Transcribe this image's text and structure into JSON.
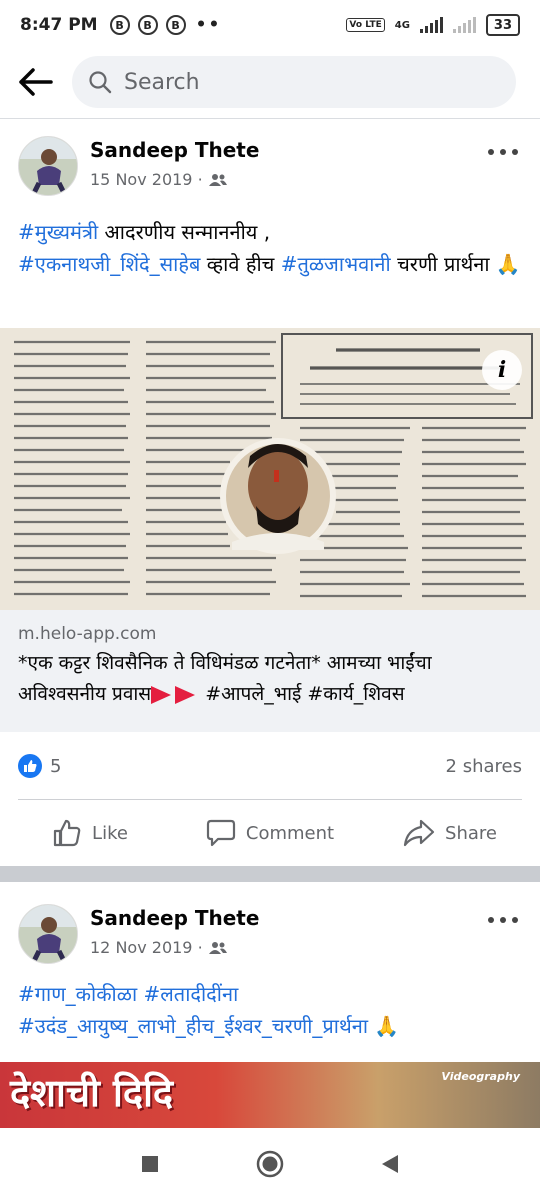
{
  "status_bar": {
    "time": "8:47 PM",
    "badges": [
      "B",
      "B",
      "B"
    ],
    "dots": "••",
    "volte": "Vo LTE",
    "network": "4G",
    "battery": "33"
  },
  "header": {
    "search_placeholder": "Search"
  },
  "posts": [
    {
      "author": "Sandeep Thete",
      "date": "15 Nov 2019 ·",
      "text_parts": [
        {
          "text": "#मुख्यमंत्री",
          "hashtag": true
        },
        {
          "text": " आदरणीय सन्माननीय ,",
          "hashtag": false
        },
        {
          "text": "#एकनाथजी_शिंदे_साहेब",
          "hashtag": true
        },
        {
          "text": " व्हावे हीच ",
          "hashtag": false
        },
        {
          "text": "#तुळजाभवानी",
          "hashtag": true
        },
        {
          "text": " चरणी प्रार्थना 🙏",
          "hashtag": false
        }
      ],
      "link": {
        "domain": "m.helo-app.com",
        "title_part1": "*एक कट्टर शिवसैनिक ते विधिमंडळ गटनेता* आमच्या भाईंचा अविश्वसनीय प्रवास",
        "title_part2": " #आपले_भाई #कार्य_शिवस"
      },
      "info_label": "i",
      "reactions_count": "5",
      "shares": "2 shares"
    },
    {
      "author": "Sandeep Thete",
      "date": "12 Nov 2019 ·",
      "text_parts": [
        {
          "text": "#गाण_कोकीळा",
          "hashtag": true
        },
        {
          "text": " ",
          "hashtag": false
        },
        {
          "text": "#लतादीदींना",
          "hashtag": true
        },
        {
          "text": "#उदंड_आयुष्य_लाभो_हीच_ईश्वर_चरणी_प्रार्थना",
          "hashtag": true
        },
        {
          "text": " 🙏",
          "hashtag": false
        }
      ],
      "banner_text": "देशाची दिदि",
      "banner_watermark": "Videography"
    }
  ],
  "actions": {
    "like": "Like",
    "comment": "Comment",
    "share": "Share"
  },
  "colors": {
    "accent": "#1877f2",
    "hashtag": "#216fdb",
    "secondary_text": "#65676b"
  }
}
